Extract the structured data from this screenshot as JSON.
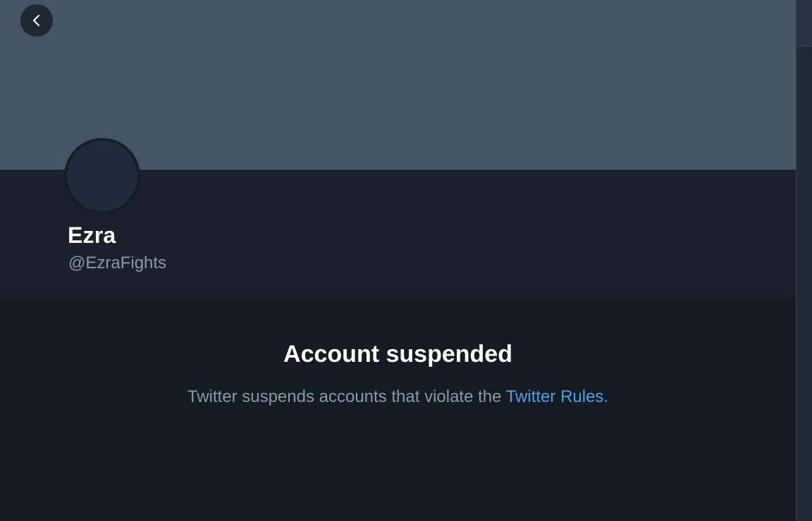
{
  "profile": {
    "display_name": "Ezra",
    "handle": "@EzraFights"
  },
  "suspension": {
    "title": "Account suspended",
    "message_prefix": "Twitter suspends accounts that violate the ",
    "rules_link": "Twitter Rules",
    "message_suffix": "."
  },
  "icons": {
    "back": "chevron-left-icon"
  },
  "colors": {
    "banner": "#445465",
    "background": "#15202b",
    "link": "#4b9fe6",
    "secondary_text": "#8899a6"
  }
}
